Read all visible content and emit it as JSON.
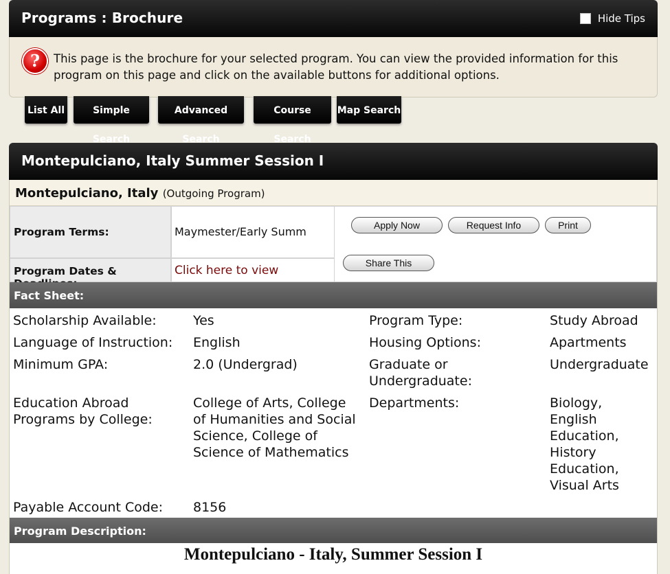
{
  "header": {
    "title": "Programs : Brochure",
    "hide_tips_label": "Hide Tips"
  },
  "tip": {
    "text": "This page is the brochure for your selected program. You can view the provided information for this program on this page and click on the available buttons for additional options."
  },
  "nav_buttons": [
    "List All",
    "Simple Search",
    "Advanced Search",
    "Course Search",
    "Map Search"
  ],
  "program": {
    "title": "Montepulciano, Italy Summer Session I",
    "location": "Montepulciano, Italy",
    "location_type": "(Outgoing Program)",
    "terms_label": "Program Terms:",
    "terms_value": "Maymester/Early Summ",
    "dates_label": "Program Dates & Deadlines:",
    "dates_link": "Click here to view",
    "actions": {
      "apply": "Apply Now",
      "request_info": "Request Info",
      "print": "Print",
      "share": "Share This"
    }
  },
  "fact_sheet": {
    "heading": "Fact Sheet:",
    "scholarship_label": "Scholarship Available:",
    "scholarship_value": "Yes",
    "language_label": "Language of Instruction:",
    "language_value": "English",
    "gpa_label": "Minimum GPA:",
    "gpa_value": "2.0 (Undergrad)",
    "college_label_1": "Education Abroad",
    "college_label_2": "Programs by College:",
    "college_value_1": "College of Arts, College",
    "college_value_2": "of Humanities and Social",
    "college_value_3": "Science, College of",
    "college_value_4": "Science of Mathematics",
    "account_label": "Payable Account Code:",
    "account_value": "8156",
    "program_type_label": "Program Type:",
    "program_type_value": "Study Abroad",
    "housing_label": "Housing Options:",
    "housing_value": "Apartments",
    "grad_label_1": "Graduate or",
    "grad_label_2": "Undergraduate:",
    "grad_value": "Undergraduate",
    "departments_label": "Departments:",
    "departments_values": [
      "Biology,",
      "English",
      "Education,",
      "History",
      "Education,",
      "Visual Arts"
    ]
  },
  "description": {
    "heading": "Program Description:",
    "title": "Montepulciano - Italy, Summer Session I"
  },
  "colors": {
    "header_bg": "#070707",
    "tip_bg": "#efeadb",
    "section_bar": "#5a5a5a",
    "link": "#7a0a0a",
    "tip_icon": "#d10000"
  }
}
